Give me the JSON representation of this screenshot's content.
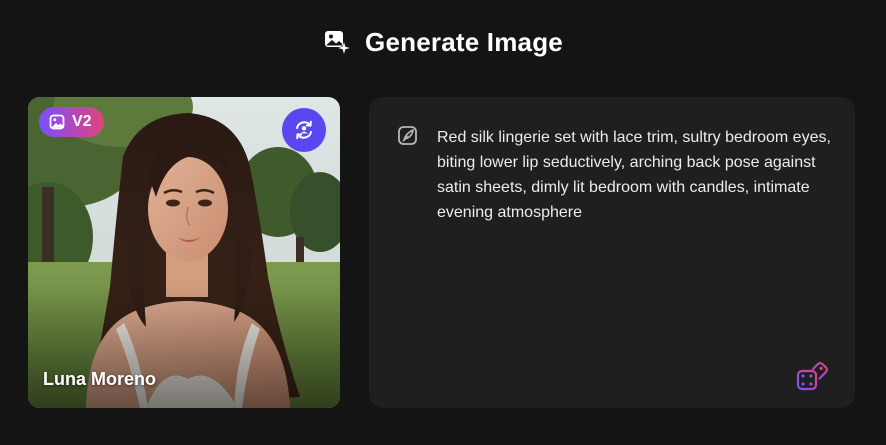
{
  "header": {
    "icon": "image-sparkle-icon",
    "title": "Generate Image"
  },
  "character_card": {
    "model_badge": {
      "icon": "image-icon",
      "label": "V2",
      "colors": [
        "#7c4dff",
        "#e0457b"
      ]
    },
    "swap_button": {
      "icon": "swap-character-icon",
      "color": "#5b47f0"
    },
    "character_name": "Luna Moreno"
  },
  "prompt_panel": {
    "icon": "edit-feather-icon",
    "prompt": "Red silk lingerie set with lace trim, sultry bedroom eyes, biting lower lip seductively, arching back pose against satin sheets, dimly lit bedroom with candles, intimate evening atmosphere",
    "random_button": {
      "icon": "dice-icon",
      "colors": [
        "#7c4dff",
        "#e0457b"
      ]
    }
  },
  "colors": {
    "background": "#141414",
    "panel": "#1f1f1f",
    "accent": "#5b47f0"
  }
}
